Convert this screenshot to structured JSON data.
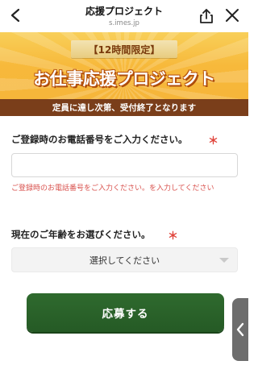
{
  "nav": {
    "title": "応援プロジェクト",
    "domain": "s.imes.jp"
  },
  "banner": {
    "ribbon": "【12時間限定】",
    "headline": "お仕事応援プロジェクト",
    "notice": "定員に達し次第、受付終了となります"
  },
  "form": {
    "phone_label": "ご登録時のお電話番号をご入力ください。",
    "required_mark": "＊",
    "phone_value": "",
    "phone_error": "ご登録時のお電話番号をご入力ください。を入力してください",
    "age_label": "現在のご年齢をお選びください。",
    "age_selected": "選択してください",
    "submit_label": "応募する"
  },
  "colors": {
    "accent_orange": "#f6b63a",
    "band_brown": "#7a3e1a",
    "button_green": "#2f6a2e",
    "error_red": "#d9534f"
  },
  "icons": {
    "back": "chevron-left-icon",
    "share": "share-icon",
    "close": "close-icon",
    "select": "caret-down-icon",
    "side_tab": "chevron-left-icon"
  }
}
